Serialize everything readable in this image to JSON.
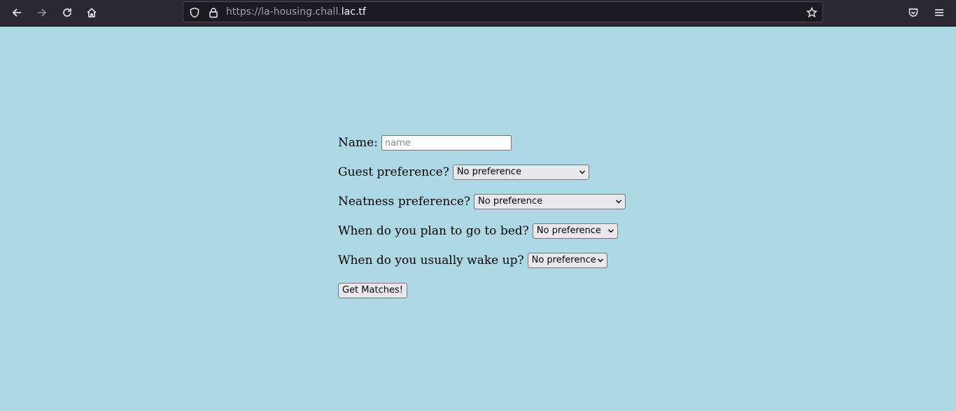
{
  "browser": {
    "url_prefix": "https://la-housing.chall.",
    "url_domain": "lac.tf"
  },
  "form": {
    "name_label": "Name:",
    "name_placeholder": "name",
    "guest_label": "Guest preference?",
    "guest_value": "No preference",
    "neatness_label": "Neatness preference?",
    "neatness_value": "No preference",
    "sleep_label": "When do you plan to go to bed?",
    "sleep_value": "No preference",
    "wake_label": "When do you usually wake up?",
    "wake_value": "No preference",
    "submit_label": "Get Matches!"
  },
  "colors": {
    "page_background": "#add8e6",
    "toolbar_background": "#2b2a33"
  }
}
